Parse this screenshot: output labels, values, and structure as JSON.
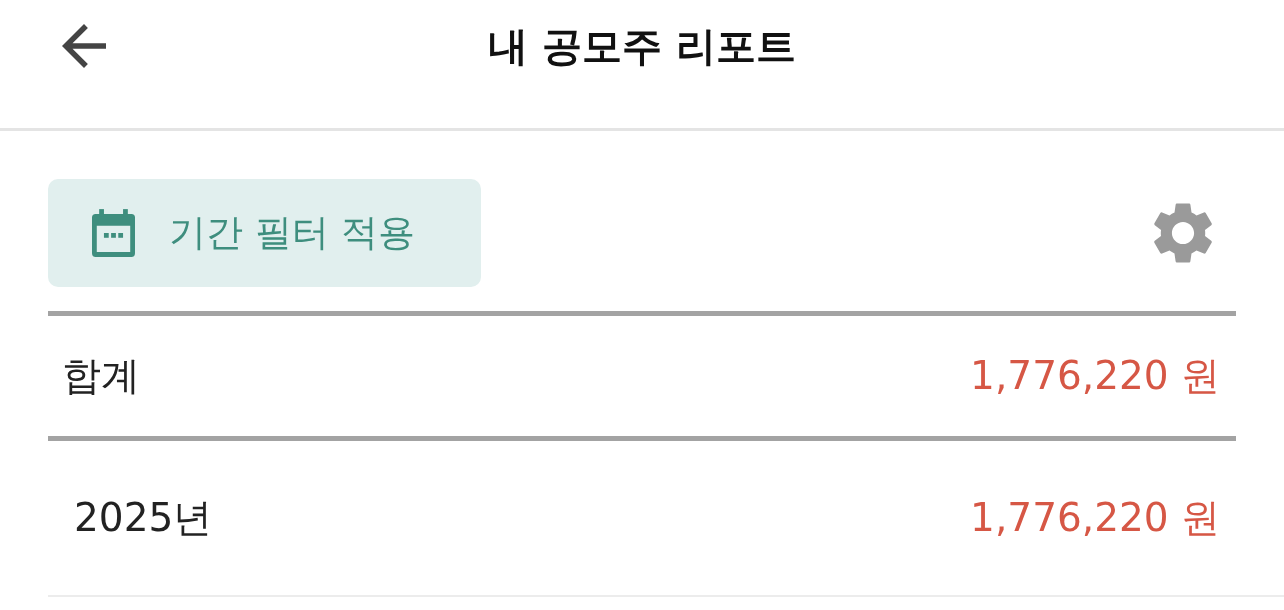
{
  "header": {
    "title": "내 공모주 리포트"
  },
  "filter_button": {
    "label": "기간 필터 적용"
  },
  "summary": {
    "label": "합계",
    "amount": "1,776,220 원"
  },
  "years": [
    {
      "label": "2025년",
      "amount": "1,776,220 원"
    }
  ]
}
